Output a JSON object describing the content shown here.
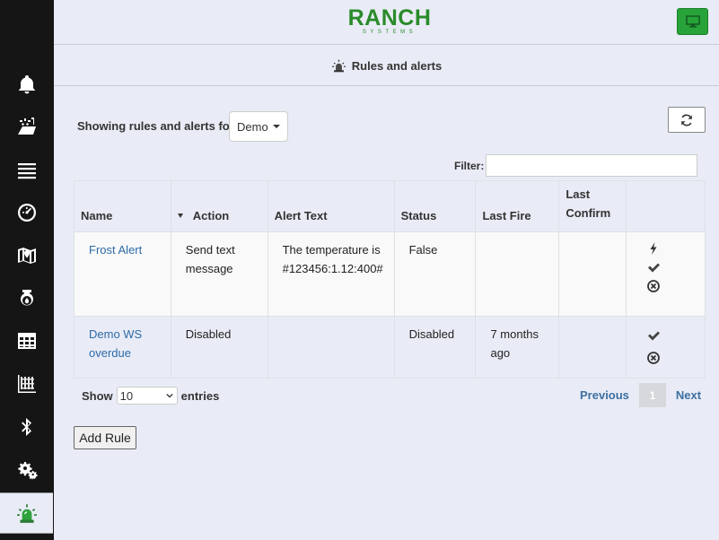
{
  "brand": {
    "name": "RANCH",
    "tagline": "SYSTEMS",
    "accent_color": "#2a8b2a"
  },
  "header": {
    "page_title": "Rules and alerts",
    "page_icon": "siren-icon"
  },
  "sidebar": {
    "items": [
      {
        "icon": "bell-icon"
      },
      {
        "icon": "field-irrigation-icon"
      },
      {
        "icon": "list-icon"
      },
      {
        "icon": "gauge-icon"
      },
      {
        "icon": "map-icon"
      },
      {
        "icon": "water-tank-icon"
      },
      {
        "icon": "table-icon"
      },
      {
        "icon": "grid-chart-icon"
      },
      {
        "icon": "bluetooth-icon"
      },
      {
        "icon": "gears-icon"
      },
      {
        "icon": "siren-icon",
        "active": true
      }
    ]
  },
  "controls": {
    "showing_label": "Showing rules and alerts for:",
    "selected_site": "Demo",
    "filter_label": "Filter:",
    "filter_value": ""
  },
  "table": {
    "columns": [
      "Name",
      "Action",
      "Alert Text",
      "Status",
      "Last Fire",
      "Last Confirm",
      ""
    ],
    "rows": [
      {
        "name": "Frost Alert",
        "action": "Send text message",
        "alert_text": "The temperature is #123456:1.12:400#",
        "status": "False",
        "last_fire": "",
        "last_confirm": "",
        "actions": [
          "fire-icon",
          "check-icon",
          "delete-icon"
        ]
      },
      {
        "name": "Demo WS overdue",
        "action": "Disabled",
        "alert_text": "",
        "status": "Disabled",
        "last_fire": "7 months ago",
        "last_confirm": "",
        "actions": [
          "check-icon",
          "delete-icon"
        ]
      }
    ]
  },
  "footer": {
    "show_label": "Show",
    "page_size": "10",
    "entries_label": "entries",
    "previous_label": "Previous",
    "current_page": "1",
    "next_label": "Next",
    "add_rule_label": "Add Rule"
  }
}
